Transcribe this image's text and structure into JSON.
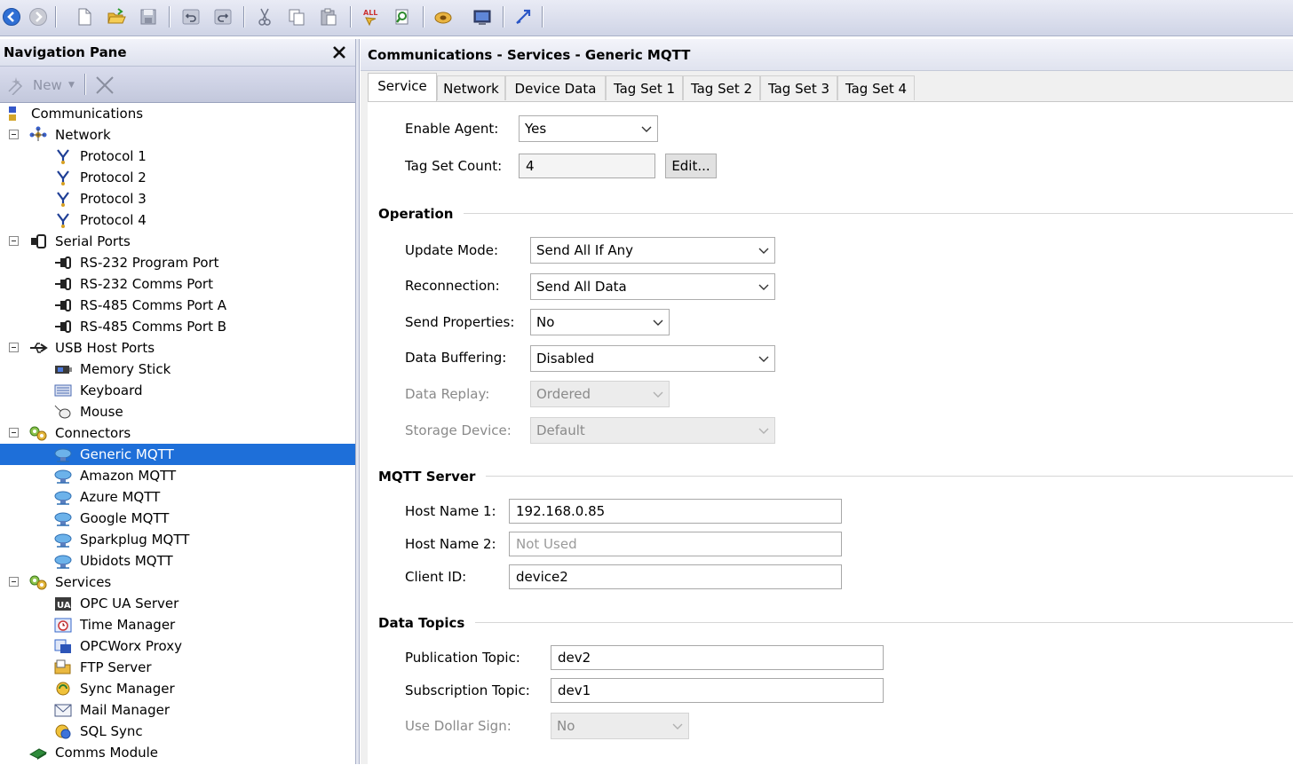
{
  "nav": {
    "title": "Navigation Pane",
    "new_label": "New",
    "tree": [
      {
        "label": "Communications",
        "icon": "communications-icon"
      },
      {
        "label": "Network",
        "icon": "network-icon"
      },
      {
        "label": "Protocol 1",
        "icon": "protocol-icon"
      },
      {
        "label": "Protocol 2",
        "icon": "protocol-icon"
      },
      {
        "label": "Protocol 3",
        "icon": "protocol-icon"
      },
      {
        "label": "Protocol 4",
        "icon": "protocol-icon"
      },
      {
        "label": "Serial Ports",
        "icon": "serial-ports-icon"
      },
      {
        "label": "RS-232 Program Port",
        "icon": "serial-port-icon"
      },
      {
        "label": "RS-232 Comms Port",
        "icon": "serial-port-icon"
      },
      {
        "label": "RS-485 Comms Port A",
        "icon": "serial-port-icon"
      },
      {
        "label": "RS-485 Comms Port B",
        "icon": "serial-port-icon"
      },
      {
        "label": "USB Host Ports",
        "icon": "usb-icon"
      },
      {
        "label": "Memory Stick",
        "icon": "memory-stick-icon"
      },
      {
        "label": "Keyboard",
        "icon": "keyboard-icon"
      },
      {
        "label": "Mouse",
        "icon": "mouse-icon"
      },
      {
        "label": "Connectors",
        "icon": "connectors-icon"
      },
      {
        "label": "Generic MQTT",
        "icon": "mqtt-cloud-icon"
      },
      {
        "label": "Amazon MQTT",
        "icon": "mqtt-cloud-icon"
      },
      {
        "label": "Azure MQTT",
        "icon": "mqtt-cloud-icon"
      },
      {
        "label": "Google MQTT",
        "icon": "mqtt-cloud-icon"
      },
      {
        "label": "Sparkplug MQTT",
        "icon": "mqtt-cloud-icon"
      },
      {
        "label": "Ubidots MQTT",
        "icon": "mqtt-cloud-icon"
      },
      {
        "label": "Services",
        "icon": "services-icon"
      },
      {
        "label": "OPC UA Server",
        "icon": "opc-ua-icon"
      },
      {
        "label": "Time Manager",
        "icon": "time-manager-icon"
      },
      {
        "label": "OPCWorx Proxy",
        "icon": "opcworx-icon"
      },
      {
        "label": "FTP Server",
        "icon": "ftp-icon"
      },
      {
        "label": "Sync Manager",
        "icon": "sync-icon"
      },
      {
        "label": "Mail Manager",
        "icon": "mail-icon"
      },
      {
        "label": "SQL Sync",
        "icon": "sql-sync-icon"
      },
      {
        "label": "Comms Module",
        "icon": "comms-module-icon"
      }
    ]
  },
  "content": {
    "title": "Communications - Services - Generic MQTT",
    "tabs": [
      "Service",
      "Network",
      "Device Data",
      "Tag Set 1",
      "Tag Set 2",
      "Tag Set 3",
      "Tag Set 4"
    ],
    "enable_agent": {
      "label": "Enable Agent:",
      "value": "Yes"
    },
    "tag_set_count": {
      "label": "Tag Set Count:",
      "value": "4",
      "button": "Edit..."
    },
    "operation": {
      "title": "Operation",
      "update_mode": {
        "label": "Update Mode:",
        "value": "Send All If Any"
      },
      "reconnection": {
        "label": "Reconnection:",
        "value": "Send All Data"
      },
      "send_properties": {
        "label": "Send Properties:",
        "value": "No"
      },
      "data_buffering": {
        "label": "Data Buffering:",
        "value": "Disabled"
      },
      "data_replay": {
        "label": "Data Replay:",
        "value": "Ordered"
      },
      "storage_device": {
        "label": "Storage Device:",
        "value": "Default"
      }
    },
    "mqtt_server": {
      "title": "MQTT Server",
      "host1": {
        "label": "Host Name 1:",
        "value": "192.168.0.85"
      },
      "host2": {
        "label": "Host Name 2:",
        "placeholder": "Not Used"
      },
      "client_id": {
        "label": "Client ID:",
        "value": "device2"
      }
    },
    "data_topics": {
      "title": "Data Topics",
      "publication": {
        "label": "Publication Topic:",
        "value": "dev2"
      },
      "subscription": {
        "label": "Subscription Topic:",
        "value": "dev1"
      },
      "dollar": {
        "label": "Use Dollar Sign:",
        "value": "No"
      }
    }
  },
  "colors": {
    "selection": "#1e6fd9",
    "toolbar": "#d7dbeb"
  }
}
